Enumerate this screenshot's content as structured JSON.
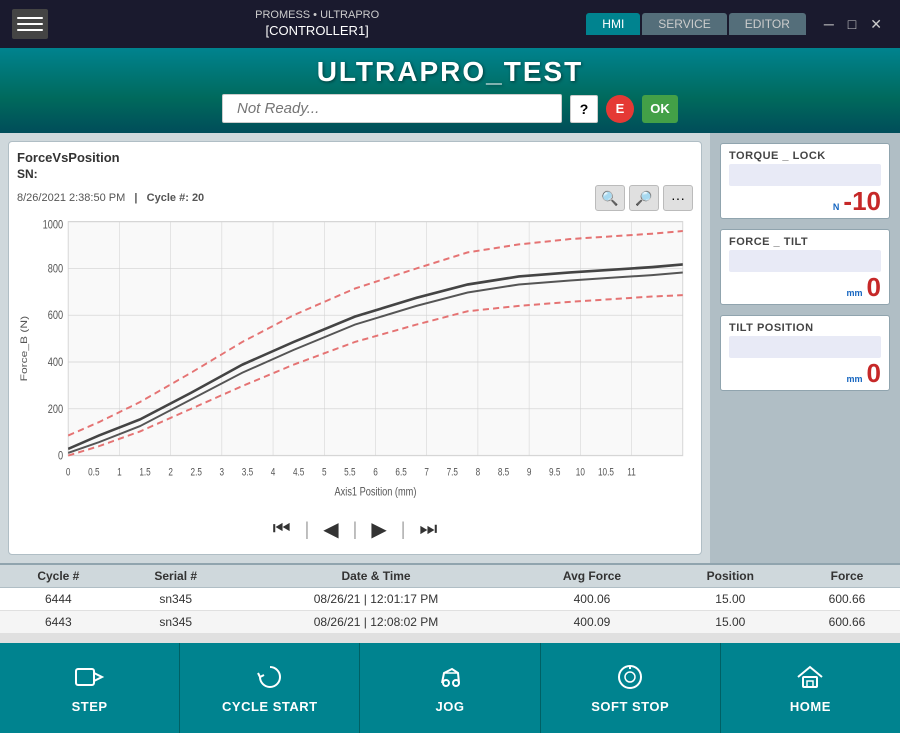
{
  "titleBar": {
    "brand": "PROMESS • ULTRAPRO",
    "controller": "[CONTROLLER1]",
    "minimize": "─",
    "maximize": "□",
    "close": "✕"
  },
  "navTabs": [
    {
      "label": "HMI",
      "active": true
    },
    {
      "label": "SERVICE",
      "active": false
    },
    {
      "label": "EDITOR",
      "active": false
    }
  ],
  "header": {
    "title": "ULTRAPRO_TEST",
    "statusPlaceholder": "Not Ready...",
    "helpLabel": "?",
    "estopLabel": "E",
    "okLabel": "OK"
  },
  "chart": {
    "title": "ForceVsPosition",
    "sn": "SN:",
    "date": "8/26/2021 2:38:50 PM",
    "separator": "|",
    "cycleLabel": "Cycle #:",
    "cycleNumber": "20",
    "xAxisLabel": "Axis1 Position (mm)",
    "yAxisLabel": "Force_B (N)"
  },
  "playback": {
    "first": "⏮",
    "prev": "◀",
    "play": "▶",
    "last": "⏭"
  },
  "metrics": [
    {
      "label": "TORQUE _ LOCK",
      "unit": "N",
      "value": "-10"
    },
    {
      "label": "FORCE _ TILT",
      "unit": "mm",
      "value": "0"
    },
    {
      "label": "TILT POSITION",
      "unit": "mm",
      "value": "0"
    }
  ],
  "table": {
    "headers": [
      "Cycle #",
      "Serial #",
      "Date & Time",
      "Avg Force",
      "Position",
      "Force"
    ],
    "rows": [
      [
        "6444",
        "sn345",
        "08/26/21  |  12:01:17 PM",
        "400.06",
        "15.00",
        "600.66"
      ],
      [
        "6443",
        "sn345",
        "08/26/21  |  12:08:02 PM",
        "400.09",
        "15.00",
        "600.66"
      ]
    ]
  },
  "toolbar": [
    {
      "label": "STEP",
      "icon": "step"
    },
    {
      "label": "CYCLE START",
      "icon": "cycle"
    },
    {
      "label": "JOG",
      "icon": "jog"
    },
    {
      "label": "SOFT STOP",
      "icon": "softstop"
    },
    {
      "label": "HOME",
      "icon": "home"
    }
  ]
}
